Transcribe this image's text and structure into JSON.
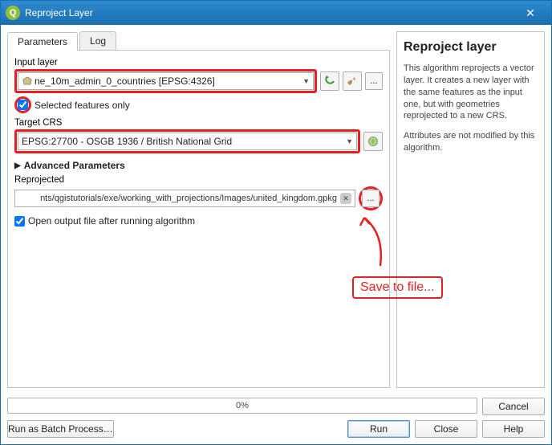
{
  "window": {
    "title": "Reproject Layer"
  },
  "tabs": {
    "parameters": "Parameters",
    "log": "Log"
  },
  "labels": {
    "input_layer": "Input layer",
    "selected_only": "Selected features only",
    "target_crs": "Target CRS",
    "advanced": "Advanced Parameters",
    "reprojected": "Reprojected",
    "open_output": "Open output file after running algorithm"
  },
  "values": {
    "input_layer": "ne_10m_admin_0_countries [EPSG:4326]",
    "target_crs": "EPSG:27700 - OSGB 1936 / British National Grid",
    "reprojected_path": "nts/qgistutorials/exe/working_with_projections/Images/united_kingdom.gpkg"
  },
  "icons": {
    "refresh": "refresh-icon",
    "wrench": "wrench-icon",
    "browse": "...",
    "crs_select": "crs-select-icon"
  },
  "callout": {
    "text": "Save to file..."
  },
  "help": {
    "title": "Reproject layer",
    "para1": "This algorithm reprojects a vector layer. It creates a new layer with the same features as the input one, but with geometries reprojected to a new CRS.",
    "para2": "Attributes are not modified by this algorithm."
  },
  "footer": {
    "progress": "0%",
    "cancel": "Cancel",
    "batch": "Run as Batch Process…",
    "run": "Run",
    "close": "Close",
    "help": "Help"
  }
}
